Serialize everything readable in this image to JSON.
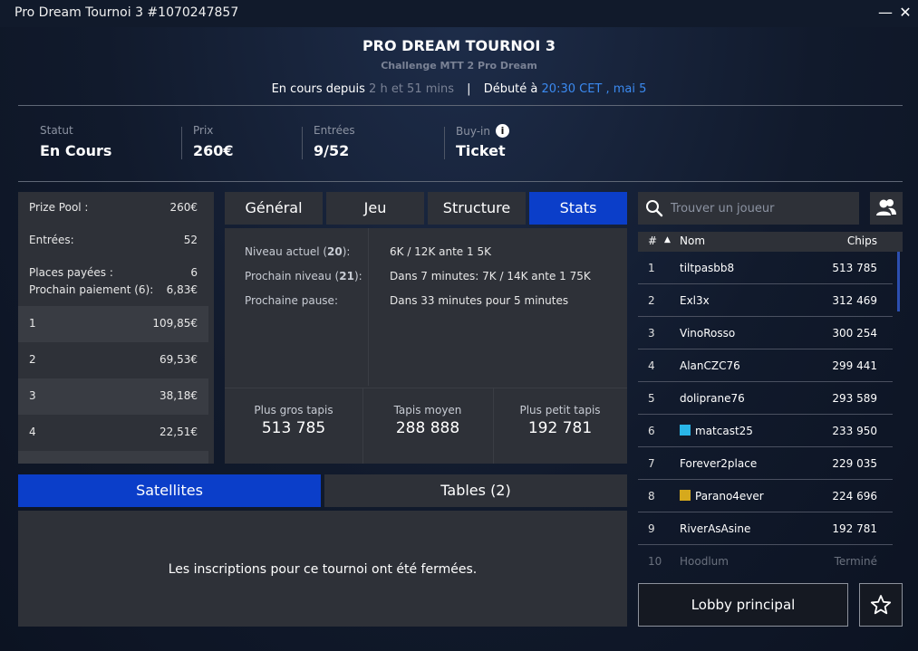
{
  "window": {
    "title": "Pro Dream Tournoi 3 #1070247857",
    "minimize": "—",
    "close": "✕"
  },
  "header": {
    "title": "PRO DREAM TOURNOI 3",
    "subtitle": "Challenge MTT 2 Pro Dream",
    "running_label": "En cours depuis",
    "running_value": "2 h et 51 mins",
    "separator": "|",
    "started_label": "Débuté à",
    "started_value": "20:30 CET , mai 5"
  },
  "info": [
    {
      "label": "Statut",
      "value": "En Cours"
    },
    {
      "label": "Prix",
      "value": "260€"
    },
    {
      "label": "Entrées",
      "value": "9/52"
    },
    {
      "label": "Buy-in",
      "value": "Ticket"
    }
  ],
  "prize": {
    "pool_label": "Prize Pool :",
    "pool_value": "260€",
    "entries_label": "Entrées:",
    "entries_value": "52",
    "paid_label": "Places payées :",
    "paid_value": "6",
    "next_label": "Prochain paiement (6):",
    "next_value": "6,83€",
    "payouts": [
      {
        "place": "1",
        "amount": "109,85€"
      },
      {
        "place": "2",
        "amount": "69,53€"
      },
      {
        "place": "3",
        "amount": "38,18€"
      },
      {
        "place": "4",
        "amount": "22,51€"
      }
    ]
  },
  "tabs": [
    "Général",
    "Jeu",
    "Structure",
    "Stats"
  ],
  "active_tab": "Stats",
  "stats": {
    "current_label_pre": "Niveau actuel (",
    "current_level": "20",
    "current_label_post": "):",
    "current_value": "6K / 12K ante 1 5K",
    "next_label_pre": "Prochain niveau (",
    "next_level": "21",
    "next_label_post": "):",
    "next_value": "Dans 7 minutes: 7K / 14K ante 1 75K",
    "pause_label": "Prochaine pause:",
    "pause_value": "Dans 33 minutes pour 5 minutes",
    "largest_label": "Plus gros tapis",
    "largest_value": "513 785",
    "average_label": "Tapis moyen",
    "average_value": "288 888",
    "smallest_label": "Plus petit tapis",
    "smallest_value": "192 781"
  },
  "bottom_tabs": [
    "Satellites",
    "Tables (2)"
  ],
  "bottom_message": "Les inscriptions pour ce tournoi ont été fermées.",
  "search": {
    "placeholder": "Trouver un joueur"
  },
  "players_header": {
    "rank": "#",
    "sort_arrow": "▲",
    "name": "Nom",
    "chips": "Chips"
  },
  "players": [
    {
      "rank": "1",
      "name": "tiltpasbb8",
      "chips": "513 785"
    },
    {
      "rank": "2",
      "name": "Exl3x",
      "chips": "312 469"
    },
    {
      "rank": "3",
      "name": "VinoRosso",
      "chips": "300 254"
    },
    {
      "rank": "4",
      "name": "AlanCZC76",
      "chips": "299 441"
    },
    {
      "rank": "5",
      "name": "doliprane76",
      "chips": "293 589"
    },
    {
      "rank": "6",
      "name": "matcast25",
      "chips": "233 950",
      "flag": "#29b6e8"
    },
    {
      "rank": "7",
      "name": "Forever2place",
      "chips": "229 035"
    },
    {
      "rank": "8",
      "name": "Parano4ever",
      "chips": "224 696",
      "flag": "#d6a91c"
    },
    {
      "rank": "9",
      "name": "RiverAsAsine",
      "chips": "192 781"
    },
    {
      "rank": "10",
      "name": "Hoodlum",
      "chips": "Terminé"
    }
  ],
  "buttons": {
    "lobby": "Lobby principal"
  },
  "icons": {
    "info": "info-icon",
    "search": "search-icon",
    "friends": "friends-icon",
    "favorite": "star-icon"
  },
  "colors": {
    "accent": "#0b3ec9",
    "link": "#3b8af0",
    "panel": "#2e3138"
  }
}
